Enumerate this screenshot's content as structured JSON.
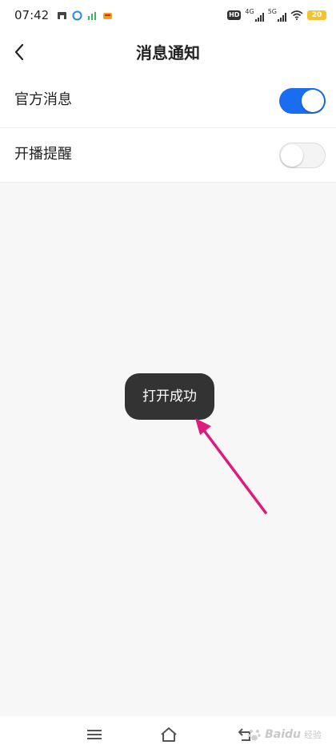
{
  "status_bar": {
    "time": "07:42",
    "hd_label": "HD",
    "net_4g": "4G",
    "net_5g": "5G",
    "battery": "20"
  },
  "header": {
    "title": "消息通知"
  },
  "settings": [
    {
      "label": "官方消息",
      "enabled": true
    },
    {
      "label": "开播提醒",
      "enabled": false
    }
  ],
  "toast": {
    "message": "打开成功"
  },
  "watermark": {
    "brand": "Baidu",
    "sub": "经验"
  },
  "colors": {
    "accent": "#1a6cf0",
    "annotation_arrow": "#e0197e",
    "toast_bg": "#333333"
  }
}
